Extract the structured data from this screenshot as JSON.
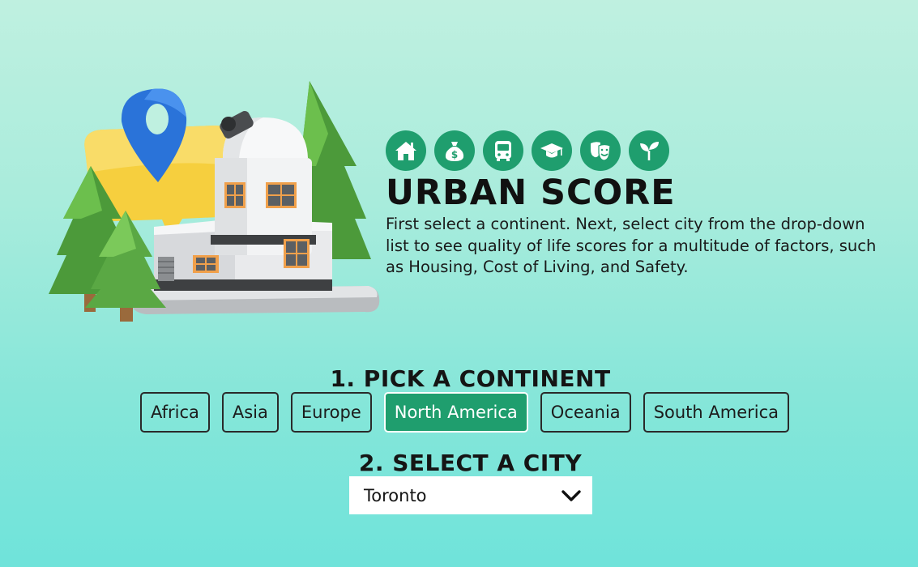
{
  "header": {
    "title": "URBAN SCORE",
    "intro": "First select a continent. Next, select city from the drop-down list to see quality of life scores for a multitude of factors, such as Housing, Cost of Living, and Safety."
  },
  "category_icons": [
    {
      "name": "house-icon"
    },
    {
      "name": "money-bag-icon"
    },
    {
      "name": "bus-icon"
    },
    {
      "name": "graduation-cap-icon"
    },
    {
      "name": "theater-masks-icon"
    },
    {
      "name": "sprout-icon"
    }
  ],
  "step1": {
    "heading": "1. PICK A CONTINENT",
    "continents": [
      "Africa",
      "Asia",
      "Europe",
      "North America",
      "Oceania",
      "South America"
    ],
    "selected": "North America"
  },
  "step2": {
    "heading": "2. SELECT A CITY",
    "selected_city": "Toronto"
  },
  "colors": {
    "accent": "#1f9e6e",
    "background_top": "#bff0e0",
    "background_bottom": "#6fe3da"
  }
}
